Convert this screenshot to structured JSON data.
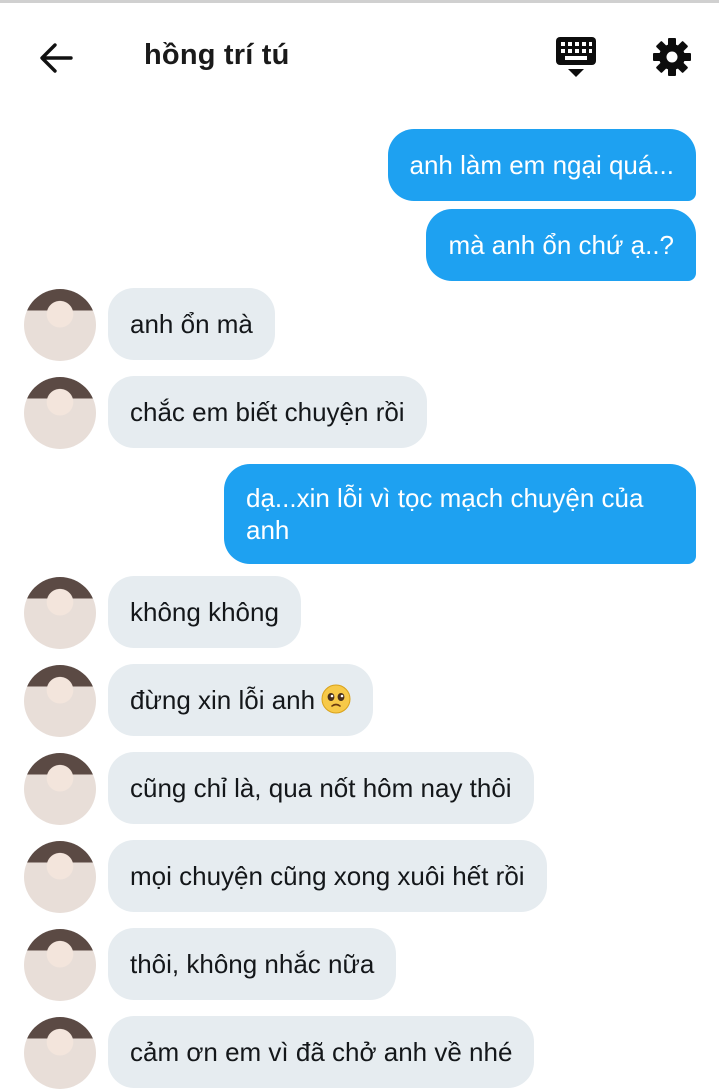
{
  "header": {
    "title": "hồng trí tú",
    "back_icon": "back-arrow-icon",
    "keyboard_icon": "keyboard-icon",
    "settings_icon": "gear-icon"
  },
  "messages": [
    {
      "side": "out",
      "text": "anh làm em ngại quá..."
    },
    {
      "side": "out",
      "text": "mà anh ổn chứ ạ..?"
    },
    {
      "side": "in",
      "text": "anh ổn mà"
    },
    {
      "side": "in",
      "text": "chắc em biết chuyện rồi"
    },
    {
      "side": "out",
      "text": "dạ...xin lỗi vì tọc mạch chuyện của anh"
    },
    {
      "side": "in",
      "text": "không không"
    },
    {
      "side": "in",
      "text": "đừng xin lỗi anh",
      "emoji": "pleading-face-emoji"
    },
    {
      "side": "in",
      "text": "cũng chỉ là, qua nốt hôm nay thôi"
    },
    {
      "side": "in",
      "text": "mọi chuyện cũng xong xuôi hết rồi"
    },
    {
      "side": "in",
      "text": "thôi, không nhắc nữa"
    },
    {
      "side": "in",
      "text": "cảm ơn em vì đã chở anh về nhé"
    }
  ],
  "colors": {
    "outgoing_bubble": "#1ea1f1",
    "incoming_bubble": "#e6ecf0"
  }
}
